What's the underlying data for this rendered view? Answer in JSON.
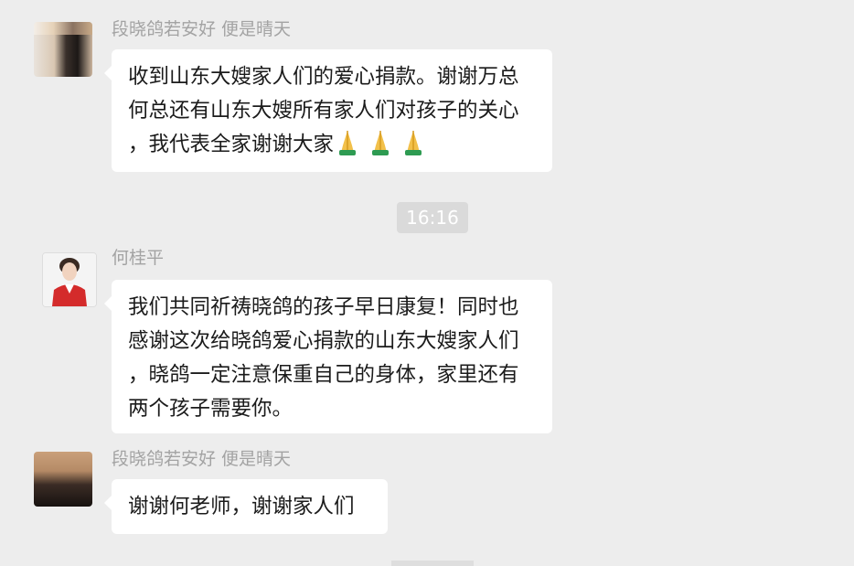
{
  "messages": [
    {
      "sender": "段晓鸽若安好   便是晴天",
      "lines": [
        "收到山东大嫂家人们的爱心捐款。谢谢万总",
        "何总还有山东大嫂所有家人们对孩子的关心",
        "，我代表全家谢谢大家"
      ],
      "emoji": "folded-hands-icon"
    },
    {
      "sender": "何桂平",
      "lines": [
        "我们共同祈祷晓鸽的孩子早日康复！同时也",
        "感谢这次给晓鸽爱心捐款的山东大嫂家人们",
        "，晓鸽一定注意保重自己的身体，家里还有",
        "两个孩子需要你。"
      ]
    },
    {
      "sender": "段晓鸽若安好   便是晴天",
      "lines": [
        "谢谢何老师，谢谢家人们"
      ]
    }
  ],
  "timestamp": "16:16",
  "colors": {
    "background": "#ededed",
    "bubble": "#ffffff",
    "sender_name": "#a3a3a3",
    "time_badge": "#dadada"
  }
}
